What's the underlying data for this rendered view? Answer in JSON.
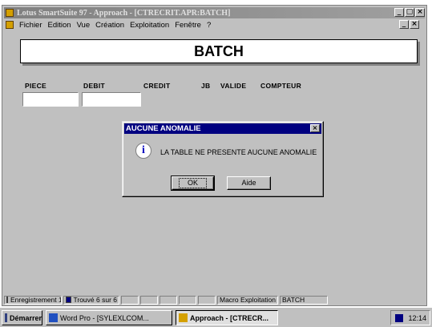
{
  "window": {
    "title": "Lotus SmartSuite 97  - Approach - [CTRECRIT.APR:BATCH]",
    "min": "_",
    "max": " ",
    "close": "×"
  },
  "menu": {
    "items": [
      "Fichier",
      "Edition",
      "Vue",
      "Création",
      "Exploitation",
      "Fenêtre",
      "?"
    ]
  },
  "form": {
    "title": "BATCH",
    "columns": [
      "PIECE",
      "DEBIT",
      "CREDIT",
      "JB",
      "VALIDE",
      "COMPTEUR"
    ]
  },
  "dialog": {
    "title": "AUCUNE ANOMALIE",
    "close": "×",
    "icon": "info-icon",
    "icon_glyph": "i",
    "message": "LA TABLE  NE PRESENTE AUCUNE ANOMALIE",
    "ok_label": "OK",
    "help_label": "Aide"
  },
  "status": {
    "record": "Enregistrement 1",
    "found": "Trouvé 6 sur 6",
    "macro": "Macro Exploitation",
    "view": "BATCH"
  },
  "taskbar": {
    "start": "Démarrer",
    "task1": "Word Pro - [SYLEXLCOM...",
    "task2": "Approach - [CTRECR...",
    "clock": "12:14"
  },
  "colors": {
    "dialog_title_bg": "#000080",
    "window_face": "#c0c0c0",
    "inactive_title": "#808080"
  }
}
